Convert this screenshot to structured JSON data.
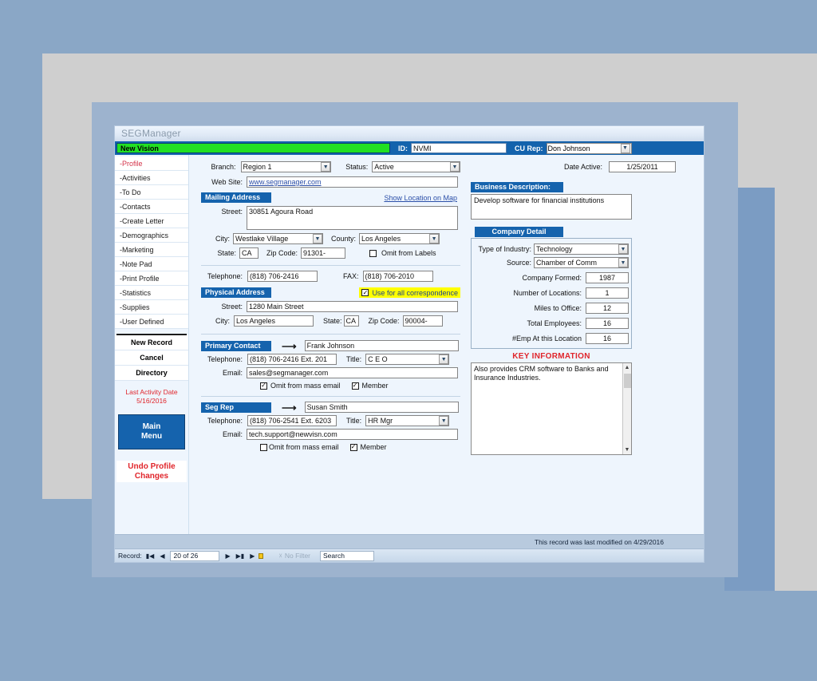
{
  "window": {
    "title": "SEGManager",
    "company_name": "New Vision",
    "id_label": "ID:",
    "id_value": "NVMI",
    "rep_label": "CU Rep:",
    "rep_value": "Don Johnson"
  },
  "sidebar": {
    "nav_items": [
      {
        "label": "-Profile",
        "active": true
      },
      {
        "label": "-Activities",
        "active": false
      },
      {
        "label": "-To Do",
        "active": false
      },
      {
        "label": "-Contacts",
        "active": false
      },
      {
        "label": "-Create Letter",
        "active": false
      },
      {
        "label": "-Demographics",
        "active": false
      },
      {
        "label": "-Marketing",
        "active": false
      },
      {
        "label": "-Note Pad",
        "active": false
      },
      {
        "label": "-Print Profile",
        "active": false
      },
      {
        "label": "-Statistics",
        "active": false
      },
      {
        "label": "-Supplies",
        "active": false
      },
      {
        "label": "-User Defined",
        "active": false
      }
    ],
    "actions": [
      {
        "label": "New Record"
      },
      {
        "label": "Cancel"
      },
      {
        "label": "Directory"
      }
    ],
    "last_activity_label": "Last Activity Date",
    "last_activity_date": "5/16/2016",
    "main_menu_line1": "Main",
    "main_menu_line2": "Menu",
    "undo_line1": "Undo Profile",
    "undo_line2": "Changes"
  },
  "form": {
    "branch_label": "Branch:",
    "branch_value": "Region 1",
    "status_label": "Status:",
    "status_value": "Active",
    "website_label": "Web Site:",
    "website_value": "www.segmanager.com",
    "date_active_label": "Date Active:",
    "date_active_value": "1/25/2011",
    "mailing": {
      "header": "Mailing Address",
      "map_link": "Show Location on Map",
      "street_label": "Street:",
      "street_value": "30851 Agoura Road",
      "city_label": "City:",
      "city_value": "Westlake Village",
      "county_label": "County:",
      "county_value": "Los Angeles",
      "state_label": "State:",
      "state_value": "CA",
      "zip_label": "Zip Code:",
      "zip_value": "91301-",
      "omit_labels": "Omit from Labels",
      "omit_labels_checked": false
    },
    "telephone_label": "Telephone:",
    "telephone_value": "(818) 706-2416",
    "fax_label": "FAX:",
    "fax_value": "(818) 706-2010",
    "physical": {
      "header": "Physical Address",
      "correspondence_label": "Use for all correspondence",
      "correspondence_checked": true,
      "street_label": "Street:",
      "street_value": "1280 Main Street",
      "city_label": "City:",
      "city_value": "Los Angeles",
      "state_label": "State:",
      "state_value": "CA",
      "zip_label": "Zip Code:",
      "zip_value": "90004-"
    },
    "primary_contact": {
      "header": "Primary Contact",
      "name": "Frank Johnson",
      "telephone_label": "Telephone:",
      "telephone_value": "(818) 706-2416 Ext.  201",
      "title_label": "Title:",
      "title_value": "C E O",
      "email_label": "Email:",
      "email_value": "sales@segmanager.com",
      "omit_mass_email": "Omit from mass email",
      "omit_mass_email_checked": true,
      "member_label": "Member",
      "member_checked": true
    },
    "seg_rep": {
      "header": "Seg Rep",
      "name": "Susan Smith",
      "telephone_label": "Telephone:",
      "telephone_value": "(818) 706-2541 Ext. 6203",
      "title_label": "Title:",
      "title_value": "HR Mgr",
      "email_label": "Email:",
      "email_value": "tech.support@newvisn.com",
      "omit_mass_email": "Omit from mass email",
      "omit_mass_email_checked": false,
      "member_label": "Member",
      "member_checked": true
    },
    "business_description": {
      "header": "Business Description:",
      "value": "Develop software for financial institutions"
    },
    "company_detail": {
      "header": "Company Detail",
      "rows": [
        {
          "label": "Type of Industry:",
          "value": "Technology",
          "type": "combo"
        },
        {
          "label": "Source:",
          "value": "Chamber of Comm",
          "type": "combo"
        },
        {
          "label": "Company Formed:",
          "value": "1987",
          "type": "text"
        },
        {
          "label": "Number of Locations:",
          "value": "1",
          "type": "text"
        },
        {
          "label": "Miles to Office:",
          "value": "12",
          "type": "text"
        },
        {
          "label": "Total Employees:",
          "value": "16",
          "type": "text"
        },
        {
          "label": "#Emp At this Location",
          "value": "16",
          "type": "text"
        }
      ]
    },
    "key_information": {
      "header": "KEY INFORMATION",
      "value": "Also provides CRM software to Banks and Insurance Industries."
    }
  },
  "footer": {
    "modified_text": "This record was last modified on 4/29/2016",
    "record_label": "Record:",
    "record_counter": "20 of 26",
    "filter_label": "No Filter",
    "search_label": "Search"
  },
  "colors": {
    "accent_blue": "#1563ad",
    "banner_green": "#22e022",
    "alert_red": "#e0252b",
    "highlight_yellow": "#ffff00"
  }
}
